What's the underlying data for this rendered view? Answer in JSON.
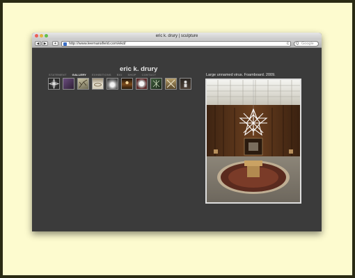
{
  "window": {
    "title": "eric k. drury | sculpture"
  },
  "toolbar": {
    "back": "◀",
    "forward": "▶",
    "add": "+",
    "url": "http://www.leemansfield.com/ekd/",
    "reload": "c",
    "search_placeholder": "Google",
    "search_icon": "Q"
  },
  "site": {
    "title": "eric k. drury",
    "menu": [
      "STATEMENT",
      "GALLERY",
      "EXHIBITIONS",
      "BIO",
      "SHOP",
      "CONTACT"
    ],
    "active_menu": "GALLERY"
  },
  "gallery": {
    "thumbnails": [
      "star-sculpture-dark",
      "purple-room",
      "branch-sculpture",
      "tabletop-rings",
      "white-sculpture",
      "lit-interior",
      "plate-sculpture",
      "green-sculpture",
      "cross-sculpture",
      "figure-sculpture"
    ],
    "caption": "Large unnamed virus. Foamboard. 2009."
  },
  "colors": {
    "background": "#fdfbcf",
    "page": "#3b3b3b",
    "active_menu": "#ffffff",
    "menu": "#7c7c7c"
  }
}
